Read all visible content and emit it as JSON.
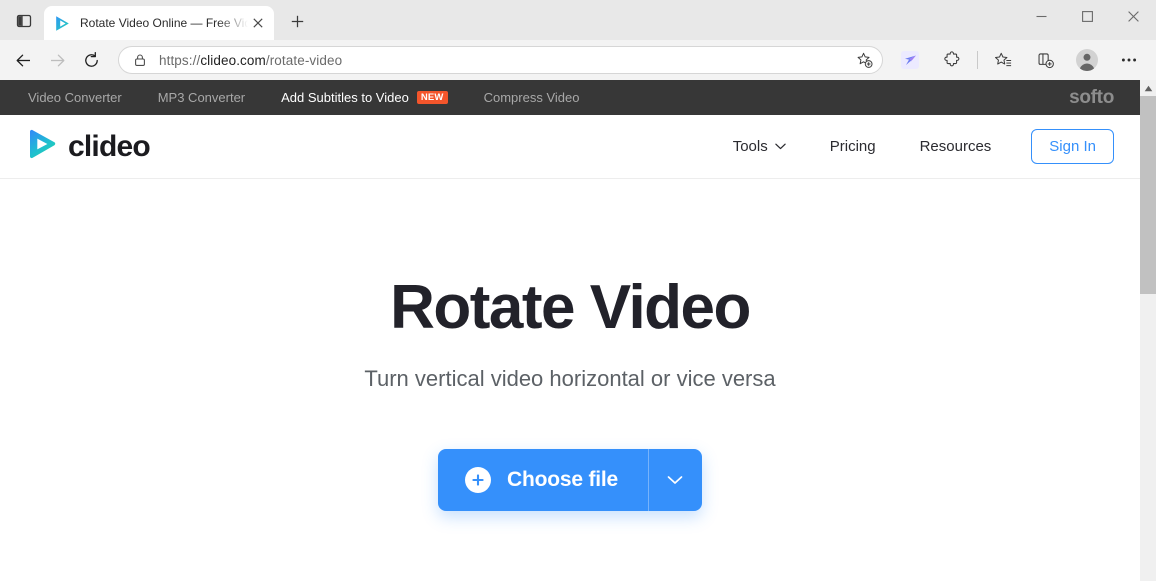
{
  "browser": {
    "tab_actions_icon": "vertical-tabs-icon",
    "tab": {
      "title": "Rotate Video Online — Free Video Rotator",
      "favicon": "clideo-play-icon",
      "close_icon": "close-icon"
    },
    "new_tab_label": "+",
    "window_controls": {
      "minimize": "minimize-icon",
      "maximize": "maximize-icon",
      "close": "close-icon"
    },
    "toolbar": {
      "back": "back-arrow-icon",
      "forward": "forward-arrow-icon",
      "refresh": "refresh-icon",
      "lock": "lock-icon",
      "url_scheme": "https://",
      "url_host": "clideo.com",
      "url_path": "/rotate-video",
      "url_full": "https://clideo.com/rotate-video",
      "add_favorite": "add-favorite-star-icon",
      "extension_bird": "extension-bird-icon",
      "extensions": "extensions-puzzle-icon",
      "favorites": "favorites-star-list-icon",
      "collections": "collections-icon",
      "profile": "profile-avatar-icon",
      "settings": "more-options-icon"
    }
  },
  "softo_bar": {
    "links": [
      {
        "label": "Video Converter",
        "active": false,
        "badge": ""
      },
      {
        "label": "MP3 Converter",
        "active": false,
        "badge": ""
      },
      {
        "label": "Add Subtitles to Video",
        "active": true,
        "badge": "NEW"
      },
      {
        "label": "Compress Video",
        "active": false,
        "badge": ""
      }
    ],
    "logo": "softo",
    "background": "#373737",
    "badge_color": "#f4552b"
  },
  "site_header": {
    "brand": "clideo",
    "brand_icon": "clideo-play-logo-icon",
    "nav": [
      {
        "label": "Tools",
        "caret": true
      },
      {
        "label": "Pricing",
        "caret": false
      },
      {
        "label": "Resources",
        "caret": false
      }
    ],
    "sign_in_label": "Sign In",
    "accent": "#3590fb"
  },
  "hero": {
    "title": "Rotate Video",
    "subtitle": "Turn vertical video horizontal or vice versa",
    "cta_label": "Choose file",
    "cta_plus_icon": "plus-circle-icon",
    "cta_caret_icon": "chevron-down-icon",
    "cta_color": "#3590fb"
  },
  "scrollbar": {
    "up_arrow": "scroll-up-arrow-icon",
    "thumb": "scroll-thumb"
  }
}
